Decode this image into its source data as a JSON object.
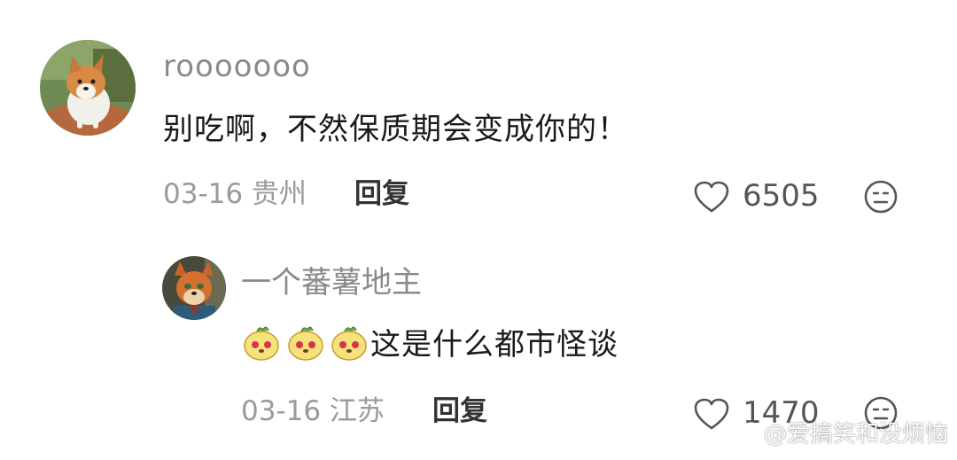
{
  "comments": [
    {
      "username": "rooooooo",
      "text": "别吃啊，不然保质期会变成你的！",
      "meta": "03-16 贵州",
      "reply_label": "回复",
      "likes": "6505",
      "avatar": "corgi-avatar"
    },
    {
      "username": "一个蕃薯地主",
      "text": "这是什么都市怪谈",
      "emojis": [
        "potato-emoji",
        "potato-emoji",
        "potato-emoji"
      ],
      "meta": "03-16 江苏",
      "reply_label": "回复",
      "likes": "1470",
      "avatar": "fox-avatar"
    }
  ],
  "watermark": "@爱搞笑和没烦恼",
  "icons": {
    "like": "heart-outline-icon",
    "dislike": "unhappy-face-icon",
    "watermark": "weibo-logo-icon"
  },
  "colors": {
    "username": "#8a8a8a",
    "meta": "#9a9a9a",
    "content": "#1a1a1a",
    "reply": "#333333"
  }
}
